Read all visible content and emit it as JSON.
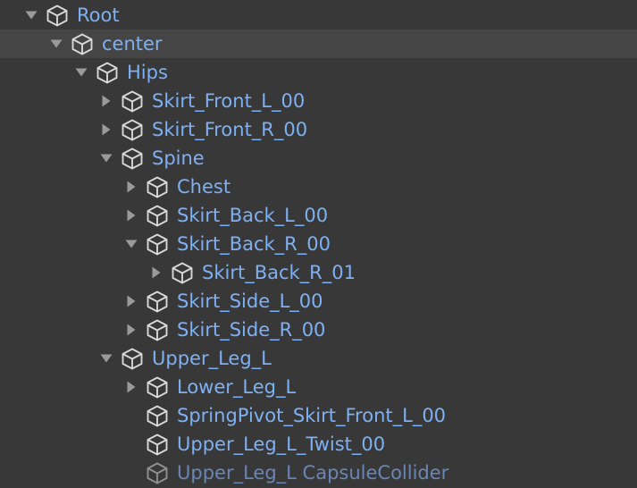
{
  "hierarchy": {
    "items": [
      {
        "label": "Root",
        "depth": 0,
        "state": "expanded"
      },
      {
        "label": "center",
        "depth": 1,
        "state": "expanded",
        "selected": true
      },
      {
        "label": "Hips",
        "depth": 2,
        "state": "expanded"
      },
      {
        "label": "Skirt_Front_L_00",
        "depth": 3,
        "state": "collapsed"
      },
      {
        "label": "Skirt_Front_R_00",
        "depth": 3,
        "state": "collapsed"
      },
      {
        "label": "Spine",
        "depth": 3,
        "state": "expanded"
      },
      {
        "label": "Chest",
        "depth": 4,
        "state": "collapsed"
      },
      {
        "label": "Skirt_Back_L_00",
        "depth": 4,
        "state": "collapsed"
      },
      {
        "label": "Skirt_Back_R_00",
        "depth": 4,
        "state": "expanded"
      },
      {
        "label": "Skirt_Back_R_01",
        "depth": 5,
        "state": "collapsed"
      },
      {
        "label": "Skirt_Side_L_00",
        "depth": 4,
        "state": "collapsed"
      },
      {
        "label": "Skirt_Side_R_00",
        "depth": 4,
        "state": "collapsed"
      },
      {
        "label": "Upper_Leg_L",
        "depth": 3,
        "state": "expanded"
      },
      {
        "label": "Lower_Leg_L",
        "depth": 4,
        "state": "collapsed"
      },
      {
        "label": "SpringPivot_Skirt_Front_L_00",
        "depth": 4,
        "state": "leaf"
      },
      {
        "label": "Upper_Leg_L_Twist_00",
        "depth": 4,
        "state": "leaf"
      },
      {
        "label": "Upper_Leg_L CapsuleCollider",
        "depth": 4,
        "state": "leaf",
        "inactive": true
      }
    ],
    "icon": "cube-icon",
    "colors": {
      "background": "#383838",
      "selected_row": "#454545",
      "label": "#7eb0f4",
      "inactive_label": "#6a86b6",
      "arrow": "#9a9a9a",
      "cube_icon": "#d8d8d8"
    }
  }
}
